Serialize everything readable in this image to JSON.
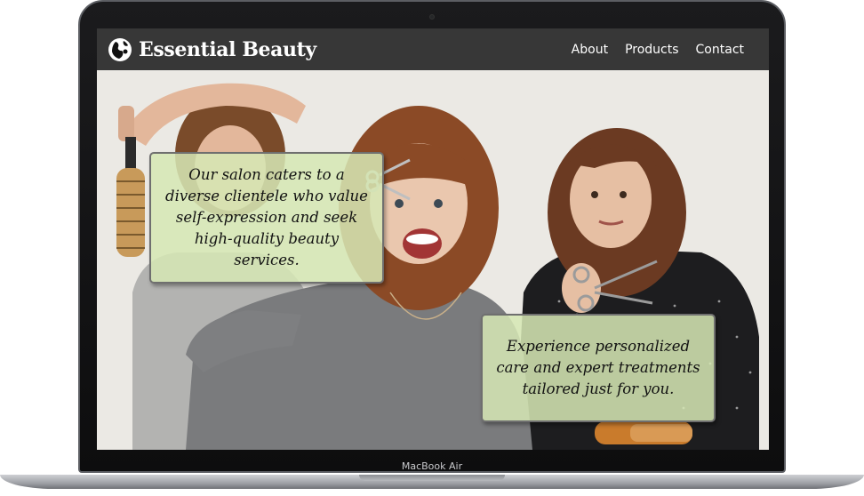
{
  "site": {
    "brand_name": "Essential Beauty",
    "logo_icon": "globe-silhouette-icon"
  },
  "nav": {
    "items": [
      {
        "label": "About"
      },
      {
        "label": "Products"
      },
      {
        "label": "Contact"
      }
    ]
  },
  "hero": {
    "callout_1": "Our salon caters to a diverse clientele who value self-expression and seek high-quality beauty services.",
    "callout_2": "Experience personalized care and expert treatments tailored just for you."
  },
  "device": {
    "label": "MacBook Air"
  },
  "colors": {
    "navbar": "#373737",
    "callout_bg": "#d6e8b4",
    "callout_border": "#6f6f6f"
  }
}
